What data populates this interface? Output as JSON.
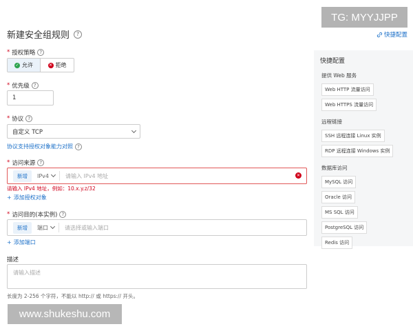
{
  "header": {
    "title": "新建安全组规则",
    "quick_config_link": "快捷配置"
  },
  "watermarks": {
    "top": "TG: MYYJJPP",
    "bottom": "www.shukeshu.com"
  },
  "policy": {
    "label": "授权策略",
    "allow": "允许",
    "deny": "拒绝",
    "selected": "允许"
  },
  "priority": {
    "label": "优先级",
    "value": "1"
  },
  "protocol": {
    "label": "协议",
    "value": "自定义 TCP",
    "support_link": "协议支持授权对象能力对照"
  },
  "source": {
    "label": "访问来源",
    "tag": "新增",
    "type": "IPv4",
    "placeholder": "请输入 IPv4 地址",
    "error": "请输入 IPv4 地址，例如：10.x.y.z/32",
    "add_link": "添加授权对象"
  },
  "destination": {
    "label": "访问目的(本实例)",
    "tag": "新增",
    "type": "端口",
    "placeholder": "请选择或输入端口",
    "add_link": "添加端口"
  },
  "description": {
    "label": "描述",
    "placeholder": "请输入描述",
    "hint": "长度为 2-256 个字符，不能以 http:// 或 https:// 开头。"
  },
  "quick_panel": {
    "title": "快捷配置",
    "groups": [
      {
        "name": "提供 Web 服务",
        "items": [
          "Web HTTP 流量访问",
          "Web HTTPS 流量访问"
        ]
      },
      {
        "name": "远程链接",
        "items": [
          "SSH 远程连接 Linux 实例",
          "RDP 远程连接 Windows 实例"
        ]
      },
      {
        "name": "数据库访问",
        "items": [
          "MySQL 访问",
          "Oracle 访问",
          "MS SQL 访问",
          "PostgreSQL 访问",
          "Redis 访问"
        ]
      }
    ]
  },
  "colors": {
    "accent": "#1f72c9",
    "error": "#d0021b",
    "success": "#2ea44f"
  }
}
